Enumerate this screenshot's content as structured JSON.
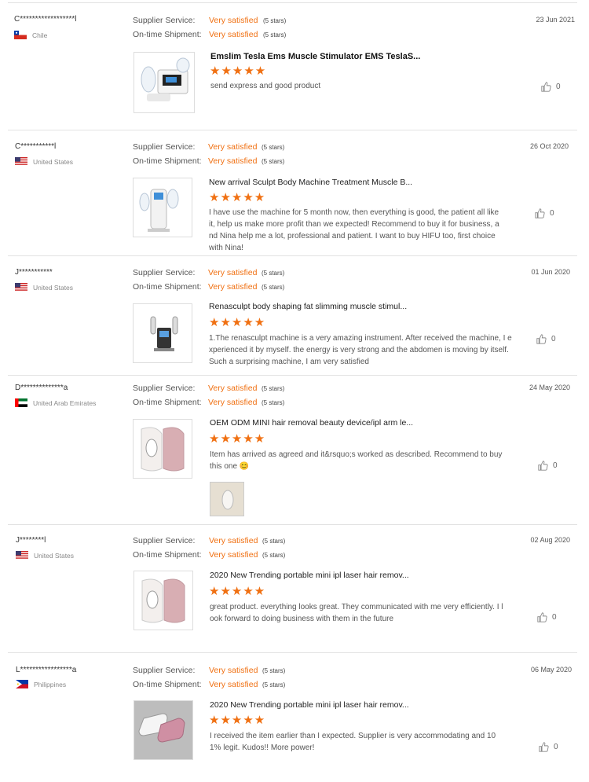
{
  "labels": {
    "supplier_service": "Supplier Service:",
    "on_time_shipment": "On-time Shipment:"
  },
  "reviews": [
    {
      "user": "C******************l",
      "country": "Chile",
      "supplier_value": "Very satisfied",
      "supplier_stars": "(5 stars)",
      "shipment_value": "Very satisfied",
      "shipment_stars": "(5 stars)",
      "date": "23 Jun 2021",
      "product_title": "Emslim Tesla Ems Muscle Stimulator EMS TeslaS...",
      "rating_stars": "★★★★★",
      "review_text": "send express and good product",
      "likes": "0"
    },
    {
      "user": "C***********l",
      "country": "United States",
      "supplier_value": "Very satisfied",
      "supplier_stars": "(5 stars)",
      "shipment_value": "Very satisfied",
      "shipment_stars": "(5 stars)",
      "date": "26 Oct 2020",
      "product_title": "New arrival Sculpt Body Machine Treatment Muscle B...",
      "rating_stars": "★★★★★",
      "review_text": "I have use the machine for 5 month now, then everything is good, the patient all like it, help us make more profit than we expected! Recommend to buy it for business, and Nina help me a lot, professional and patient. I want to buy HIFU too, first choice with Nina!",
      "likes": "0"
    },
    {
      "user": "J***********",
      "country": "United States",
      "supplier_value": "Very satisfied",
      "supplier_stars": "(5 stars)",
      "shipment_value": "Very satisfied",
      "shipment_stars": "(5 stars)",
      "date": "01 Jun 2020",
      "product_title": "Renasculpt body shaping fat slimming muscle stimul...",
      "rating_stars": "★★★★★",
      "review_text": "1.The renasculpt machine is a very amazing instrument. After received the machine, I experienced it by myself. the energy is very strong and the abdomen is moving by itself. Such a surprising machine, I am very satisfied",
      "likes": "0"
    },
    {
      "user": "D**************a",
      "country": "United Arab Emirates",
      "supplier_value": "Very satisfied",
      "supplier_stars": "(5 stars)",
      "shipment_value": "Very satisfied",
      "shipment_stars": "(5 stars)",
      "date": "24 May 2020",
      "product_title": "OEM ODM MINI hair removal beauty device/ipl arm le...",
      "rating_stars": "★★★★★",
      "review_text": "Item has arrived as agreed and it&rsquo;s worked as described. Recommend to buy this one 😊",
      "likes": "0"
    },
    {
      "user": "J********l",
      "country": "United States",
      "supplier_value": "Very satisfied",
      "supplier_stars": "(5 stars)",
      "shipment_value": "Very satisfied",
      "shipment_stars": "(5 stars)",
      "date": "02 Aug 2020",
      "product_title": "2020 New Trending portable mini ipl laser hair remov...",
      "rating_stars": "★★★★★",
      "review_text": "great product. everything looks great. They communicated with me very efficiently. I look forward to doing business with them in the future",
      "likes": "0"
    },
    {
      "user": "L*****************a",
      "country": "Philippines",
      "supplier_value": "Very satisfied",
      "supplier_stars": "(5 stars)",
      "shipment_value": "Very satisfied",
      "shipment_stars": "(5 stars)",
      "date": "06 May 2020",
      "product_title": "2020 New Trending portable mini ipl laser hair remov...",
      "rating_stars": "★★★★★",
      "review_text": "I received the item earlier than I expected. Supplier is very accommodating and 101% legit. Kudos!! More power!",
      "likes": "0"
    }
  ],
  "colors": {
    "accent": "#f07012",
    "divider": "#e2e2e2"
  }
}
